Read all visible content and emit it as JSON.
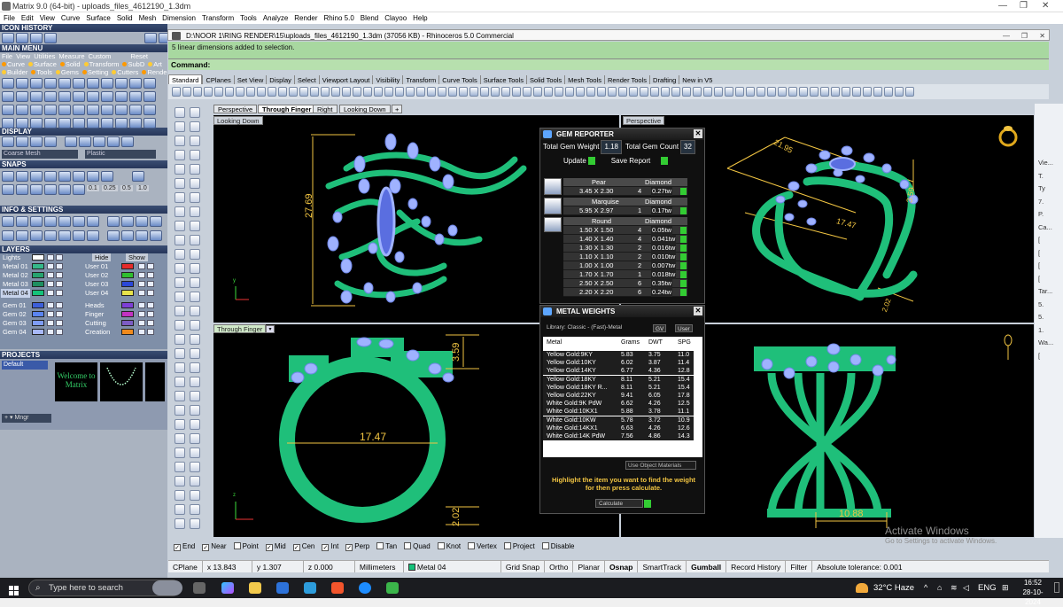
{
  "window_title": "Matrix 9.0 (64-bit) - uploads_files_4612190_1.3dm",
  "menu": [
    "File",
    "Edit",
    "View",
    "Curve",
    "Surface",
    "Solid",
    "Mesh",
    "Dimension",
    "Transform",
    "Tools",
    "Analyze",
    "Render",
    "Rhino 5.0",
    "Blend",
    "Clayoo",
    "Help"
  ],
  "left_panel": {
    "icon_history_title": "ICON HISTORY",
    "main_menu_title": "MAIN MENU",
    "main_menu_row1": [
      "File",
      "View",
      "Utilities",
      "Measure",
      "Custom",
      "Reset"
    ],
    "main_menu_row2": [
      "Curve",
      "Surface",
      "Solid",
      "Transform",
      "SubD",
      "Art"
    ],
    "main_menu_row3": [
      "Builder",
      "Tools",
      "Gems",
      "Setting",
      "Cutters",
      "Render"
    ],
    "display_title": "DISPLAY",
    "display_mode_1": "Coarse Mesh",
    "display_mode_2": "Plastic",
    "snaps_title": "SNAPS",
    "snap_values": [
      "0.1",
      "0.25",
      "0.5",
      "1.0"
    ],
    "info_title": "INFO & SETTINGS",
    "layers_title": "LAYERS",
    "layers_hide": "Hide",
    "layers_show": "Show",
    "layers_left": [
      "Lights",
      "Metal 01",
      "Metal 02",
      "Metal 03",
      "Metal 04",
      "",
      "Gem 01",
      "Gem 02",
      "Gem 03",
      "Gem 04"
    ],
    "layers_right": [
      "",
      "User 01",
      "User 02",
      "User 03",
      "User 04",
      "",
      "Heads",
      "Finger",
      "Cutting",
      "Creation"
    ],
    "layers_right_colors": [
      "",
      "#e52b2b",
      "#2fbf2f",
      "#2a47d8",
      "#e7e24a",
      "",
      "#7d3fd6",
      "#c232c2",
      "#7c5cc4",
      "#f08a1c"
    ],
    "projects_title": "PROJECTS",
    "projects_default": "Default",
    "project_thumb_text": "Welcome to Matrix",
    "projects_mngr": "Mngr"
  },
  "doc_header": "D:\\NOOR 1\\RING RENDER\\15\\uploads_files_4612190_1.3dm (37056 KB) - Rhinoceros 5.0 Commercial",
  "history_text": "5 linear dimensions added to selection.",
  "command_label": "Command:",
  "toolbar_tabs": [
    "Standard",
    "CPlanes",
    "Set View",
    "Display",
    "Select",
    "Viewport Layout",
    "Visibility",
    "Transform",
    "Curve Tools",
    "Surface Tools",
    "Solid Tools",
    "Mesh Tools",
    "Render Tools",
    "Drafting",
    "New in V5"
  ],
  "viewport_tabs": [
    "Perspective",
    "Through Finger",
    "Right",
    "Looking Down"
  ],
  "viewports": {
    "top_left": "Looking Down",
    "top_right": "Perspective",
    "bottom_left": "Through Finger"
  },
  "dimensions": {
    "height_top": "27.69",
    "width_persp": "21.95",
    "persp_inner": "17.47",
    "persp_right": "3.59",
    "persp_base": "2.02",
    "front_height": "3.59",
    "front_inner": "17.47",
    "front_base": "2.02",
    "side_base": "10.88"
  },
  "gem_reporter": {
    "title": "GEM REPORTER",
    "total_weight_label": "Total Gem Weight",
    "total_weight": "1.18",
    "total_count_label": "Total Gem Count",
    "total_count": "32",
    "update_label": "Update",
    "save_label": "Save Report",
    "groups": [
      {
        "shape": "Pear",
        "material": "Diamond",
        "rows": [
          {
            "size": "3.45 X 2.30",
            "count": "4",
            "tw": "0.27tw"
          }
        ]
      },
      {
        "shape": "Marquise",
        "material": "Diamond",
        "rows": [
          {
            "size": "5.95 X 2.97",
            "count": "1",
            "tw": "0.17tw"
          }
        ]
      },
      {
        "shape": "Round",
        "material": "Diamond",
        "rows": [
          {
            "size": "1.50 X 1.50",
            "count": "4",
            "tw": "0.05tw"
          },
          {
            "size": "1.40 X 1.40",
            "count": "4",
            "tw": "0.041tw"
          },
          {
            "size": "1.30 X 1.30",
            "count": "2",
            "tw": "0.016tw"
          },
          {
            "size": "1.10 X 1.10",
            "count": "2",
            "tw": "0.010tw"
          },
          {
            "size": "1.00 X 1.00",
            "count": "2",
            "tw": "0.007tw"
          },
          {
            "size": "1.70 X 1.70",
            "count": "1",
            "tw": "0.018tw"
          },
          {
            "size": "2.50 X 2.50",
            "count": "6",
            "tw": "0.35tw"
          },
          {
            "size": "2.20 X 2.20",
            "count": "6",
            "tw": "0.24tw"
          }
        ]
      }
    ]
  },
  "metal_weights": {
    "title": "METAL WEIGHTS",
    "library": "Library: Classic - (Fast)-Metal",
    "tab_gv": "GV",
    "tab_user": "User",
    "headers": [
      "Metal",
      "Grams",
      "DWT",
      "SPG"
    ],
    "rows": [
      [
        "Yellow Gold:9KY",
        "5.83",
        "3.75",
        "11.0"
      ],
      [
        "Yellow Gold:10KY",
        "6.02",
        "3.87",
        "11.4"
      ],
      [
        "Yellow Gold:14KY",
        "6.77",
        "4.36",
        "12.8"
      ],
      [
        "Yellow Gold:18KY",
        "8.11",
        "5.21",
        "15.4"
      ],
      [
        "Yellow Gold:18KY R...",
        "8.11",
        "5.21",
        "15.4"
      ],
      [
        "Yellow Gold:22KY",
        "9.41",
        "6.05",
        "17.8"
      ],
      [
        "White Gold:9K PdW",
        "6.62",
        "4.26",
        "12.5"
      ],
      [
        "White Gold:10KX1",
        "5.88",
        "3.78",
        "11.1"
      ],
      [
        "White Gold:10KW",
        "5.78",
        "3.72",
        "10.9"
      ],
      [
        "White Gold:14KX1",
        "6.63",
        "4.26",
        "12.6"
      ],
      [
        "White Gold:14K PdW",
        "7.56",
        "4.86",
        "14.3"
      ]
    ],
    "use_obj_label": "Use Object Materials",
    "hint": "Highlight the item you want to find the weight for then press calculate.",
    "calc_label": "Calculate"
  },
  "right_panel": [
    "Vie...",
    "T.",
    "Ty",
    "7.",
    "P.",
    "Ca...",
    "[",
    "[",
    "[",
    "[",
    "Tar...",
    "5.",
    "5.",
    "1.",
    "Wa...",
    "["
  ],
  "osnaps": [
    {
      "label": "End",
      "on": true
    },
    {
      "label": "Near",
      "on": true
    },
    {
      "label": "Point",
      "on": false
    },
    {
      "label": "Mid",
      "on": true
    },
    {
      "label": "Cen",
      "on": true
    },
    {
      "label": "Int",
      "on": true
    },
    {
      "label": "Perp",
      "on": true
    },
    {
      "label": "Tan",
      "on": false
    },
    {
      "label": "Quad",
      "on": false
    },
    {
      "label": "Knot",
      "on": false
    },
    {
      "label": "Vertex",
      "on": false
    },
    {
      "label": "Project",
      "on": false
    },
    {
      "label": "Disable",
      "on": false
    }
  ],
  "status": {
    "cplane": "CPlane",
    "x": "x 13.843",
    "y": "y 1.307",
    "z": "z 0.000",
    "units": "Millimeters",
    "layer": "Metal 04",
    "grid_snap": "Grid Snap",
    "ortho": "Ortho",
    "planar": "Planar",
    "osnap": "Osnap",
    "smarttrack": "SmartTrack",
    "gumball": "Gumball",
    "record": "Record History",
    "filter": "Filter",
    "tolerance": "Absolute tolerance: 0.001"
  },
  "watermark": {
    "title": "Activate Windows",
    "sub": "Go to Settings to activate Windows."
  },
  "taskbar": {
    "search_placeholder": "Type here to search",
    "weather": "32°C Haze",
    "lang": "ENG",
    "time": "16:52",
    "date": "28-10-2024"
  },
  "colors": {
    "metal": "#1fbf7a",
    "gem": "#9fb2ff",
    "dimension": "#f2c542"
  }
}
